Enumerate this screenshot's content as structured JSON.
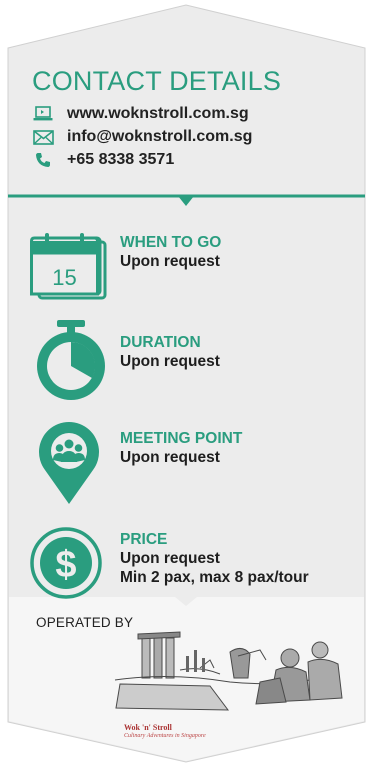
{
  "contact": {
    "title": "CONTACT DETAILS",
    "website": "www.woknstroll.com.sg",
    "email": "info@woknstroll.com.sg",
    "phone": "+65 8338 3571"
  },
  "details": [
    {
      "heading": "WHEN TO GO",
      "value": "Upon request",
      "calendar_day": "15",
      "icon": "calendar-icon"
    },
    {
      "heading": "DURATION",
      "value": "Upon request",
      "icon": "stopwatch-icon"
    },
    {
      "heading": "MEETING POINT",
      "value": "Upon request",
      "icon": "map-pin-group-icon"
    },
    {
      "heading": "PRICE",
      "value": "Upon request",
      "value2": "Min 2 pax, max 8 pax/tour",
      "icon": "dollar-icon"
    }
  ],
  "operated_by": {
    "label": "OPERATED BY",
    "logo_name": "Wok 'n' Stroll",
    "logo_tagline": "Culinary Adventures in Singapore"
  },
  "colors": {
    "accent": "#2a9d7f",
    "panel": "#ececec",
    "panel_light": "#f5f5f5"
  }
}
